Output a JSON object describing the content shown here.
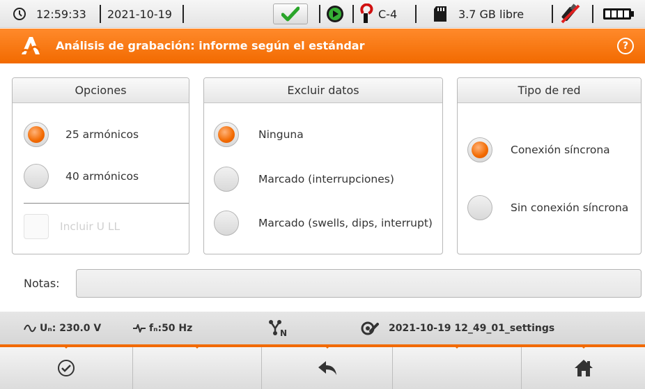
{
  "status": {
    "time": "12:59:33",
    "date": "2021-10-19",
    "clamp": "C-4",
    "storage": "3.7 GB libre"
  },
  "title": "Análisis de grabación: informe según el estándar",
  "help_glyph": "?",
  "panels": {
    "options": {
      "header": "Opciones",
      "items": [
        {
          "label": "25 armónicos",
          "selected": true
        },
        {
          "label": "40 armónicos",
          "selected": false
        }
      ],
      "checkbox_label": "Incluir U LL"
    },
    "exclude": {
      "header": "Excluir datos",
      "items": [
        {
          "label": "Ninguna",
          "selected": true
        },
        {
          "label": "Marcado (interrupciones)",
          "selected": false
        },
        {
          "label": "Marcado (swells, dips, interrupt)",
          "selected": false
        }
      ]
    },
    "network": {
      "header": "Tipo de red",
      "items": [
        {
          "label": "Conexión síncrona",
          "selected": true
        },
        {
          "label": "Sin conexión síncrona",
          "selected": false
        }
      ]
    }
  },
  "notes": {
    "label": "Notas:",
    "value": ""
  },
  "info": {
    "un": "Uₙ: 230.0 V",
    "fn": "fₙ:50 Hz",
    "settings_file": "2021-10-19 12_49_01_settings"
  },
  "colors": {
    "accent": "#f26a00"
  }
}
